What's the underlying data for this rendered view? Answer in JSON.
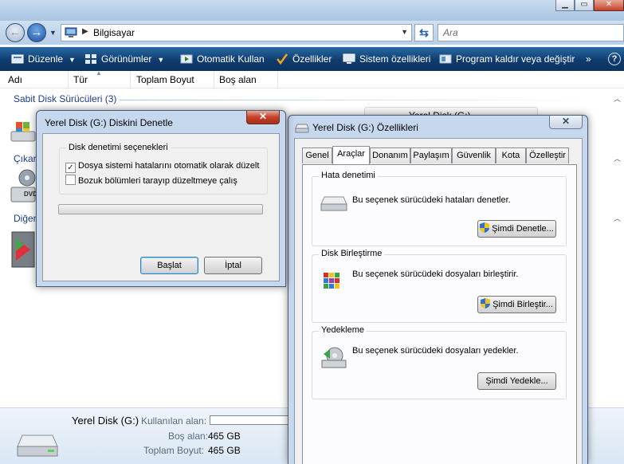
{
  "explorer": {
    "address": {
      "location": "Bilgisayar"
    },
    "search": {
      "placeholder": "Ara"
    },
    "toolbar": {
      "organize": "Düzenle",
      "views": "Görünümler",
      "autoplay": "Otomatik Kullan",
      "properties": "Özellikler",
      "system_properties": "Sistem özellikleri",
      "uninstall": "Program kaldır veya değiştir",
      "more": "»",
      "help": "?"
    },
    "columns": [
      "Adı",
      "Tür",
      "Toplam Boyut",
      "Boş alan"
    ],
    "groups": {
      "hard_disks": "Sabit Disk Sürücüleri (3)",
      "removable": "Çıkar",
      "other": "Diğer"
    },
    "tile_behind": "Yerel Disk (G:)",
    "details": {
      "name": "Yerel Disk (G:)",
      "used_label": "Kullanılan alan:",
      "free_label": "Boş alan:",
      "free_value": "465 GB",
      "total_label": "Toplam Boyut:",
      "total_value": "465 GB"
    }
  },
  "check_dialog": {
    "title": "Yerel Disk (G:) Diskini Denetle",
    "close": "✕",
    "options_group": "Disk denetimi seçenekleri",
    "option1": {
      "label": "Dosya sistemi hatalarını otomatik olarak düzelt",
      "checked": true
    },
    "option2": {
      "label": "Bozuk bölümleri tarayıp düzeltmeye çalış",
      "checked": false
    },
    "progress": 0,
    "start_button": "Başlat",
    "cancel_button": "İptal"
  },
  "properties_dialog": {
    "title": "Yerel Disk (G:) Özellikleri",
    "close": "✕",
    "tabs": [
      "Genel",
      "Araçlar",
      "Donanım",
      "Paylaşım",
      "Güvenlik",
      "Kota",
      "Özelleştir"
    ],
    "active_tab": "Araçlar",
    "error_check": {
      "group": "Hata denetimi",
      "description": "Bu seçenek sürücüdeki hataları denetler.",
      "button": "Şimdi Denetle..."
    },
    "defrag": {
      "group": "Disk Birleştirme",
      "description": "Bu seçenek sürücüdeki dosyaları birleştirir.",
      "button": "Şimdi Birleştir..."
    },
    "backup": {
      "group": "Yedekleme",
      "description": "Bu seçenek sürücüdeki dosyaları yedekler.",
      "button": "Şimdi Yedekle..."
    }
  },
  "colors": {
    "toolbar_bg": "#0f3c6e",
    "group_header": "#1e3c8c",
    "window_frame": "#c6d8ee",
    "close_red": "#c6412a",
    "default_button_border": "#3c7fb1"
  }
}
